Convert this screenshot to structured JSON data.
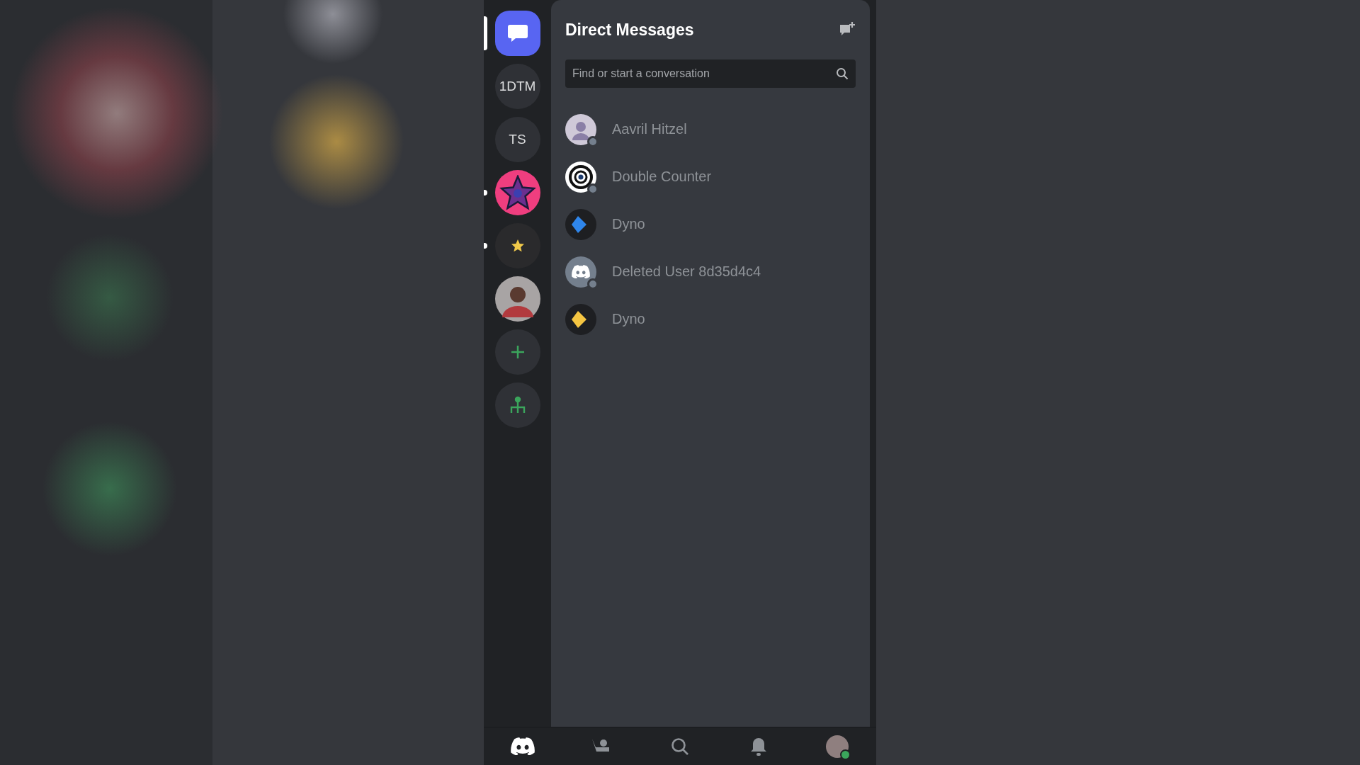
{
  "servers": [
    {
      "kind": "home",
      "selected": true,
      "unread": false
    },
    {
      "kind": "text",
      "label": "1DTM",
      "selected": false,
      "unread": false
    },
    {
      "kind": "text",
      "label": "TS",
      "selected": false,
      "unread": false
    },
    {
      "kind": "star-art",
      "selected": false,
      "unread": true
    },
    {
      "kind": "star-dark",
      "selected": false,
      "unread": true
    },
    {
      "kind": "photo",
      "selected": false,
      "unread": false
    },
    {
      "kind": "add",
      "selected": false,
      "unread": false
    },
    {
      "kind": "discover",
      "selected": false,
      "unread": false
    }
  ],
  "direct_messages": {
    "title": "Direct Messages",
    "search": {
      "placeholder": "Find or start a conversation"
    },
    "items": [
      {
        "name": "Aavril Hitzel",
        "kind": "photo",
        "offline": true
      },
      {
        "name": "Double Counter",
        "kind": "target",
        "offline": true
      },
      {
        "name": "Dyno",
        "kind": "diamond",
        "color": "#2f86eb",
        "offline": false
      },
      {
        "name": "Deleted User 8d35d4c4",
        "kind": "discord",
        "offline": true
      },
      {
        "name": "Dyno",
        "kind": "diamond",
        "color": "#f5c542",
        "offline": false
      }
    ]
  },
  "bottom_nav": [
    {
      "kind": "home",
      "selected": true
    },
    {
      "kind": "friends",
      "selected": false
    },
    {
      "kind": "search",
      "selected": false
    },
    {
      "kind": "notifications",
      "selected": false
    },
    {
      "kind": "profile",
      "selected": false,
      "online": true
    }
  ]
}
